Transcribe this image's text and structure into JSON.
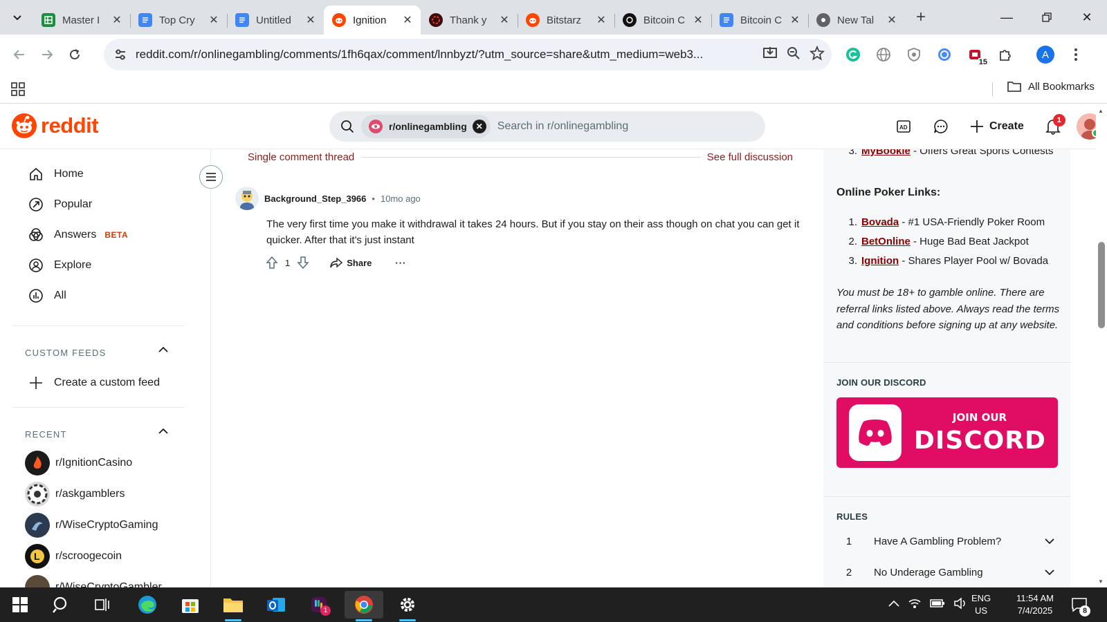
{
  "browser": {
    "tabs": [
      {
        "title": "Master I",
        "icon": "google-sheets-icon",
        "active": false
      },
      {
        "title": "Top Cry",
        "icon": "google-docs-icon",
        "active": false
      },
      {
        "title": "Untitled",
        "icon": "google-docs-icon",
        "active": false
      },
      {
        "title": "Ignition",
        "icon": "reddit-icon",
        "active": true
      },
      {
        "title": "Thank y",
        "icon": "casino-chip-icon",
        "active": false
      },
      {
        "title": "Bitstarz",
        "icon": "reddit-icon",
        "active": false
      },
      {
        "title": "Bitcoin C",
        "icon": "openai-icon",
        "active": false
      },
      {
        "title": "Bitcoin C",
        "icon": "google-docs-icon",
        "active": false
      },
      {
        "title": "New Tal",
        "icon": "chrome-icon",
        "active": false
      }
    ],
    "url": "reddit.com/r/onlinegambling/comments/1fh6qax/comment/lnnbyzt/?utm_source=share&utm_medium=web3...",
    "extension_badge": "15",
    "profile_initial": "A",
    "bookmarks_all": "All Bookmarks"
  },
  "reddit": {
    "logo_text": "reddit",
    "search": {
      "chip_label": "r/onlinegambling",
      "placeholder": "Search in r/onlinegambling"
    },
    "header": {
      "create_label": "Create",
      "notification_count": "1"
    },
    "sidebar": {
      "nav": [
        {
          "label": "Home",
          "icon": "home-icon"
        },
        {
          "label": "Popular",
          "icon": "popular-icon"
        },
        {
          "label": "Answers",
          "icon": "answers-icon",
          "badge": "BETA"
        },
        {
          "label": "Explore",
          "icon": "explore-icon"
        },
        {
          "label": "All",
          "icon": "all-icon"
        }
      ],
      "custom_feeds_title": "CUSTOM FEEDS",
      "create_custom_feed": "Create a custom feed",
      "recent_title": "RECENT",
      "recent": [
        {
          "label": "r/IgnitionCasino",
          "color": "#1b1b1b"
        },
        {
          "label": "r/askgamblers",
          "color": "#d9d9d9"
        },
        {
          "label": "r/WiseCryptoGaming",
          "color": "#2b3a4f"
        },
        {
          "label": "r/scroogecoin",
          "color": "#111111"
        },
        {
          "label": "r/WiseCryptoGambler",
          "color": "#5a4a3a"
        }
      ]
    },
    "thread": {
      "label": "Single comment thread",
      "full_discussion": "See full discussion"
    },
    "comment": {
      "author": "Background_Step_3966",
      "separator": "•",
      "time": "10mo ago",
      "body": "The very first time you make it withdrawal it takes 24 hours. But if you stay on their ass though on chat you can get it quicker. After that it's just instant",
      "votes": "1",
      "share_label": "Share",
      "more_label": "···"
    },
    "right_sidebar": {
      "top_item": {
        "num": "3.",
        "name": "MyBookie",
        "desc": " - Offers Great Sports Contests"
      },
      "poker_heading": "Online Poker Links:",
      "poker_links": [
        {
          "num": "1.",
          "name": "Bovada",
          "desc": " - #1 USA-Friendly Poker Room"
        },
        {
          "num": "2.",
          "name": "BetOnline",
          "desc": " - Huge Bad Beat Jackpot"
        },
        {
          "num": "3.",
          "name": "Ignition",
          "desc": " - Shares Player Pool w/ Bovada"
        }
      ],
      "disclaimer": "You must be 18+ to gamble online. There are referral links listed above. Always read the terms and conditions before signing up at any website.",
      "discord_caption": "JOIN OUR DISCORD",
      "discord_banner_top": "JOIN OUR",
      "discord_banner_main": "DISCORD",
      "rules_caption": "RULES",
      "rules": [
        {
          "num": "1",
          "title": "Have A Gambling Problem?"
        },
        {
          "num": "2",
          "title": "No Underage Gambling"
        }
      ]
    }
  },
  "taskbar": {
    "lang_top": "ENG",
    "lang_bottom": "US",
    "time": "11:54 AM",
    "date": "7/4/2025",
    "notification_count": "8",
    "slack_badge": "1"
  },
  "colors": {
    "reddit_orange": "#ff4500",
    "link_red": "#8b0000",
    "discord_pink": "#e10d64",
    "chrome_frame": "#dee1e6"
  }
}
